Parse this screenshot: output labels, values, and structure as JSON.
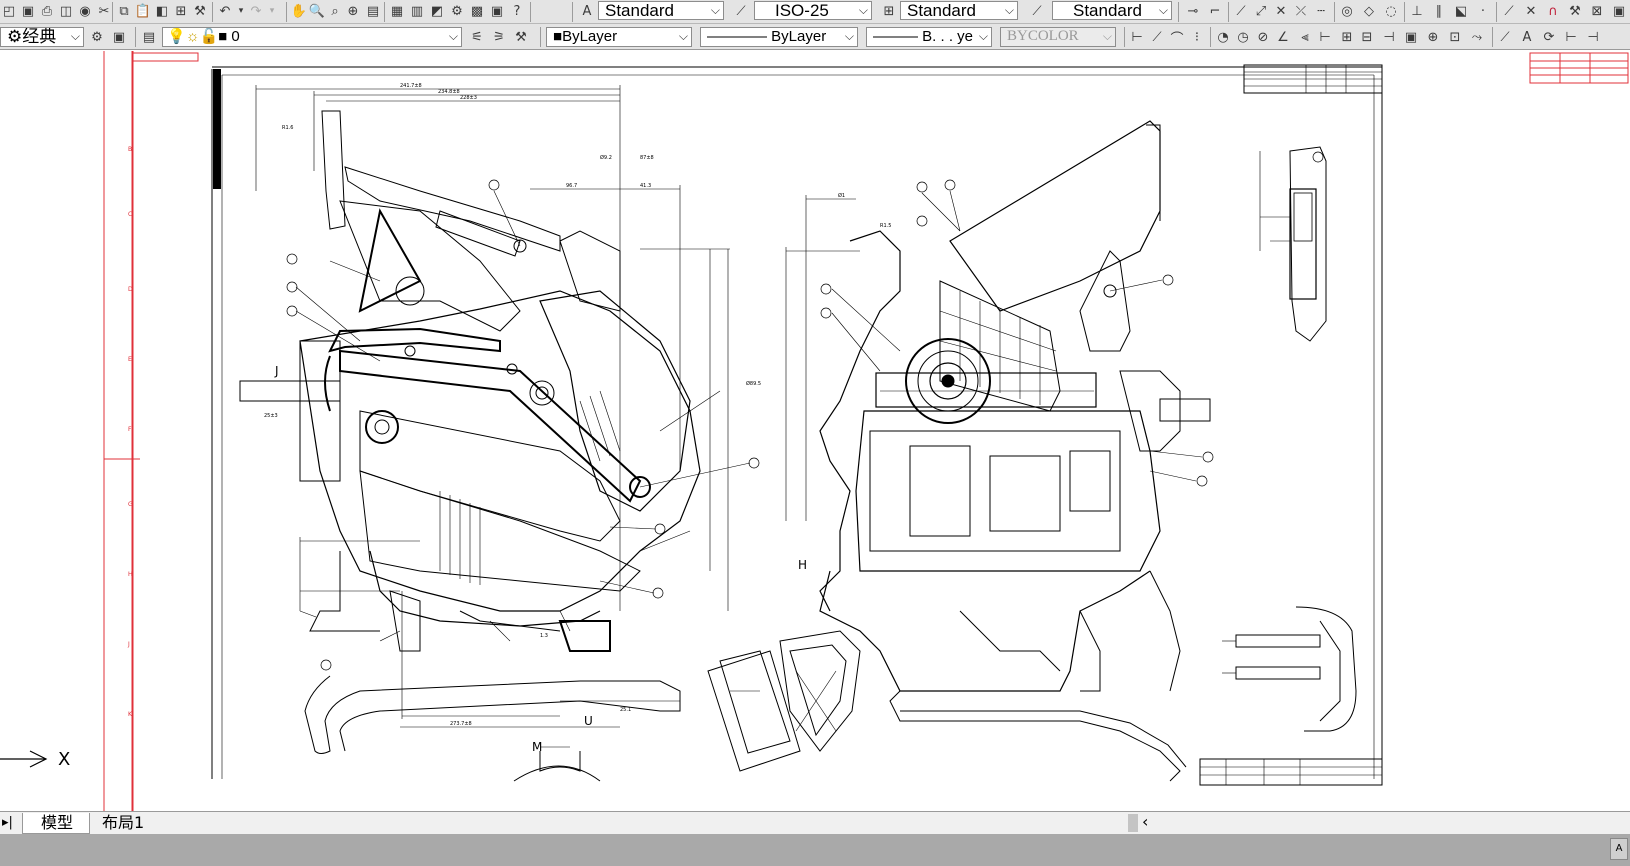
{
  "toolbar1": {
    "text_style": "Standard",
    "dim_style": "ISO-25",
    "table_style": "Standard",
    "multileader_style": "Standard"
  },
  "toolbar2": {
    "workspace": "经典",
    "layer": "0",
    "color": "ByLayer",
    "linetype": "ByLayer",
    "lineweight": "B. . . ye",
    "plotstyle": "BYCOLOR"
  },
  "tabs": {
    "model": "模型",
    "layout1": "布局1"
  },
  "ucs": {
    "x_label": "X"
  },
  "drawing": {
    "labels": [
      "J",
      "M",
      "U",
      "H"
    ],
    "dims": [
      "241.7±8",
      "234.8±8",
      "228±3",
      "R1.6",
      "96.7",
      "41.3",
      "Ø9.2",
      "87±8",
      "25±3",
      "Ø89.5",
      "1.3",
      "25.1",
      "Ø1",
      "R1.5",
      "273.7±8"
    ]
  },
  "colors": {
    "accent_red": "#e0303a",
    "toolbar_bg": "#e4e4e4",
    "status_bg": "#a9a9a9"
  }
}
